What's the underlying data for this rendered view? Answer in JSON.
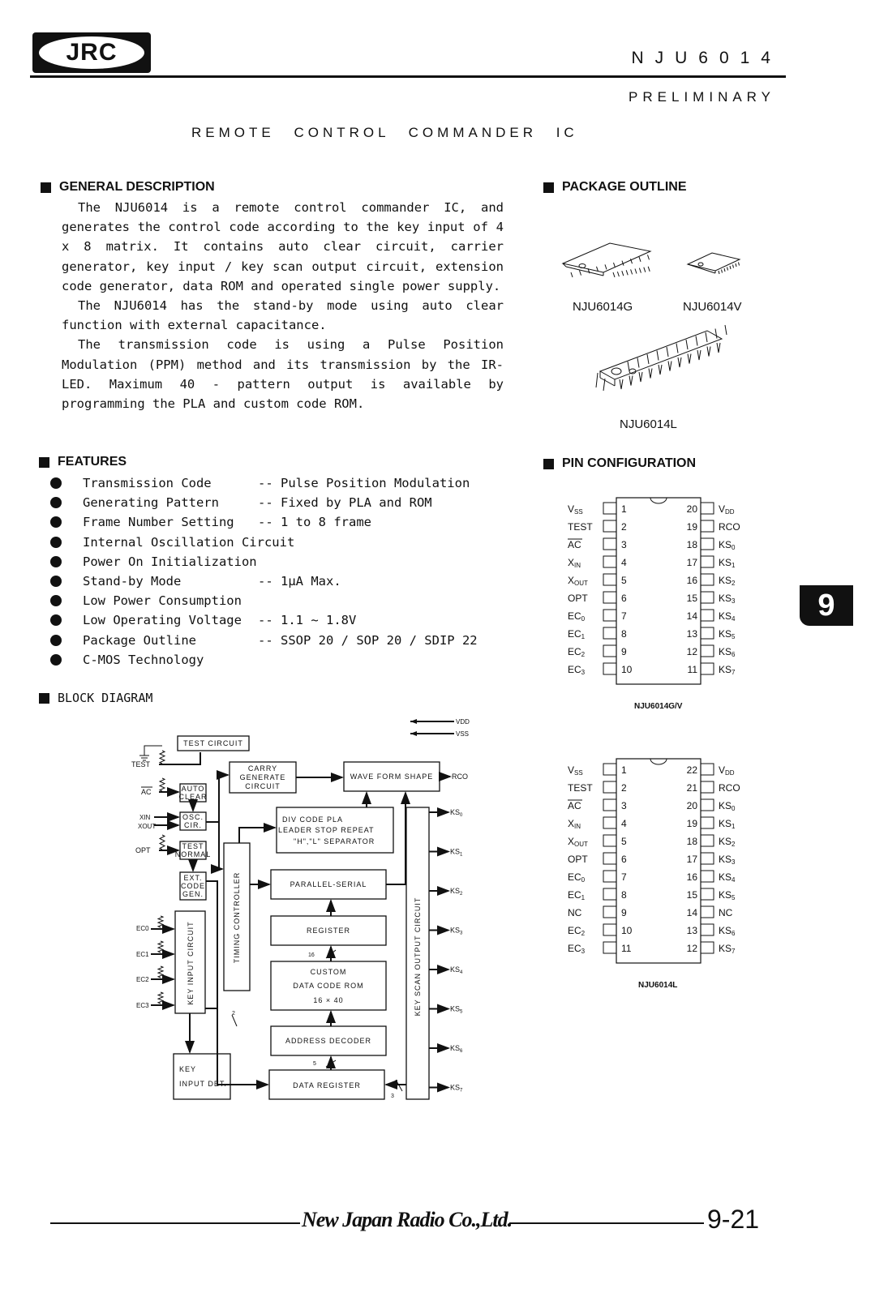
{
  "header": {
    "logo": "JRC",
    "part_number": "NJU6014",
    "status": "PRELIMINARY",
    "title": "REMOTE CONTROL COMMANDER IC"
  },
  "general_description": {
    "heading": "GENERAL DESCRIPTION",
    "paragraphs": [
      "The NJU6014 is a remote control commander IC, and generates the control code according to the key input of 4 x 8 matrix. It contains auto clear circuit, carrier generator, key input / key scan output circuit, extension code generator, data ROM and operated single power supply.",
      "The NJU6014 has the stand-by mode using auto clear function with external capacitance.",
      "The transmission code is using a Pulse Position Modulation (PPM) method and its transmission by the IR-LED. Maximum 40 - pattern output is available by programming the PLA and custom code ROM."
    ]
  },
  "features": {
    "heading": "FEATURES",
    "items": [
      {
        "name": "Transmission Code",
        "value": "-- Pulse Position Modulation"
      },
      {
        "name": "Generating Pattern",
        "value": "-- Fixed by PLA and ROM"
      },
      {
        "name": "Frame Number Setting",
        "value": "-- 1 to 8 frame"
      },
      {
        "name": "Internal Oscillation Circuit",
        "value": ""
      },
      {
        "name": "Power On Initialization",
        "value": ""
      },
      {
        "name": "Stand-by Mode",
        "value": "-- 1µA Max."
      },
      {
        "name": "Low Power Consumption",
        "value": ""
      },
      {
        "name": "Low Operating Voltage",
        "value": "-- 1.1 ~ 1.8V"
      },
      {
        "name": "Package Outline",
        "value": "-- SSOP 20 / SOP 20 / SDIP 22"
      },
      {
        "name": "C-MOS Technology",
        "value": ""
      }
    ]
  },
  "package_outline": {
    "heading": "PACKAGE OUTLINE",
    "packages": [
      "NJU6014G",
      "NJU6014V",
      "NJU6014L"
    ]
  },
  "pin_configuration": {
    "heading": "PIN CONFIGURATION",
    "diagrams": [
      {
        "caption": "NJU6014G/V",
        "left": [
          [
            "Vss",
            "1"
          ],
          [
            "TEST",
            "2"
          ],
          [
            "AC",
            "3"
          ],
          [
            "XIN",
            "4"
          ],
          [
            "XOUT",
            "5"
          ],
          [
            "OPT",
            "6"
          ],
          [
            "EC0",
            "7"
          ],
          [
            "EC1",
            "8"
          ],
          [
            "EC2",
            "9"
          ],
          [
            "EC3",
            "10"
          ]
        ],
        "right": [
          [
            "VDD",
            "20"
          ],
          [
            "RCO",
            "19"
          ],
          [
            "KS0",
            "18"
          ],
          [
            "KS1",
            "17"
          ],
          [
            "KS2",
            "16"
          ],
          [
            "KS3",
            "15"
          ],
          [
            "KS4",
            "14"
          ],
          [
            "KS5",
            "13"
          ],
          [
            "KS6",
            "12"
          ],
          [
            "KS7",
            "11"
          ]
        ]
      },
      {
        "caption": "NJU6014L",
        "left": [
          [
            "Vss",
            "1"
          ],
          [
            "TEST",
            "2"
          ],
          [
            "AC",
            "3"
          ],
          [
            "XIN",
            "4"
          ],
          [
            "XOUT",
            "5"
          ],
          [
            "OPT",
            "6"
          ],
          [
            "EC0",
            "7"
          ],
          [
            "EC1",
            "8"
          ],
          [
            "NC",
            "9"
          ],
          [
            "EC2",
            "10"
          ],
          [
            "EC3",
            "11"
          ]
        ],
        "right": [
          [
            "VDD",
            "22"
          ],
          [
            "RCO",
            "21"
          ],
          [
            "KS0",
            "20"
          ],
          [
            "KS1",
            "19"
          ],
          [
            "KS2",
            "18"
          ],
          [
            "KS3",
            "17"
          ],
          [
            "KS4",
            "16"
          ],
          [
            "KS5",
            "15"
          ],
          [
            "NC",
            "14"
          ],
          [
            "KS6",
            "13"
          ],
          [
            "KS7",
            "12"
          ]
        ]
      }
    ]
  },
  "block_diagram": {
    "heading": "BLOCK DIAGRAM",
    "blocks": {
      "test_circuit": "TEST CIRCUIT",
      "carry": [
        "CARRY",
        "GENERATE",
        "CIRCUIT"
      ],
      "wave": "WAVE FORM SHAPE",
      "auto_clear": [
        "AUTO",
        "CLEAR"
      ],
      "osc": [
        "OSC.",
        "CIR."
      ],
      "test_normal": [
        "TEST",
        "NORMAL"
      ],
      "ext_code": [
        "EXT.",
        "CODE",
        "GEN."
      ],
      "div_code": [
        "DIV CODE PLA",
        "LEADER STOP REPEAT",
        "\"H\",\"L\" SEPARATOR"
      ],
      "timing": "TIMING CONTROLLER",
      "parallel_serial": "PARALLEL-SERIAL",
      "register": "REGISTER",
      "custom_rom": [
        "CUSTOM",
        "DATA CODE ROM",
        "16 × 40"
      ],
      "address_decoder": "ADDRESS DECODER",
      "data_register": "DATA REGISTER",
      "key_input": "KEY INPUT CIRCUIT",
      "key_input_det": [
        "KEY",
        "INPUT DET."
      ],
      "key_scan": "KEY SCAN OUTPUT CIRCUIT"
    },
    "inputs": [
      "TEST",
      "AC",
      "XIN",
      "XOUT",
      "OPT",
      "EC0",
      "EC1",
      "EC2",
      "EC3"
    ],
    "power": [
      "VDD",
      "VSS"
    ],
    "outputs": [
      "RCO",
      "KS0",
      "KS1",
      "KS2",
      "KS3",
      "KS4",
      "KS5",
      "KS6",
      "KS7"
    ],
    "bus_widths": [
      "16",
      "2",
      "5",
      "3"
    ]
  },
  "side_tab": "9",
  "footer": {
    "company": "New Japan Radio Co.,Ltd.",
    "page": "9-21"
  }
}
